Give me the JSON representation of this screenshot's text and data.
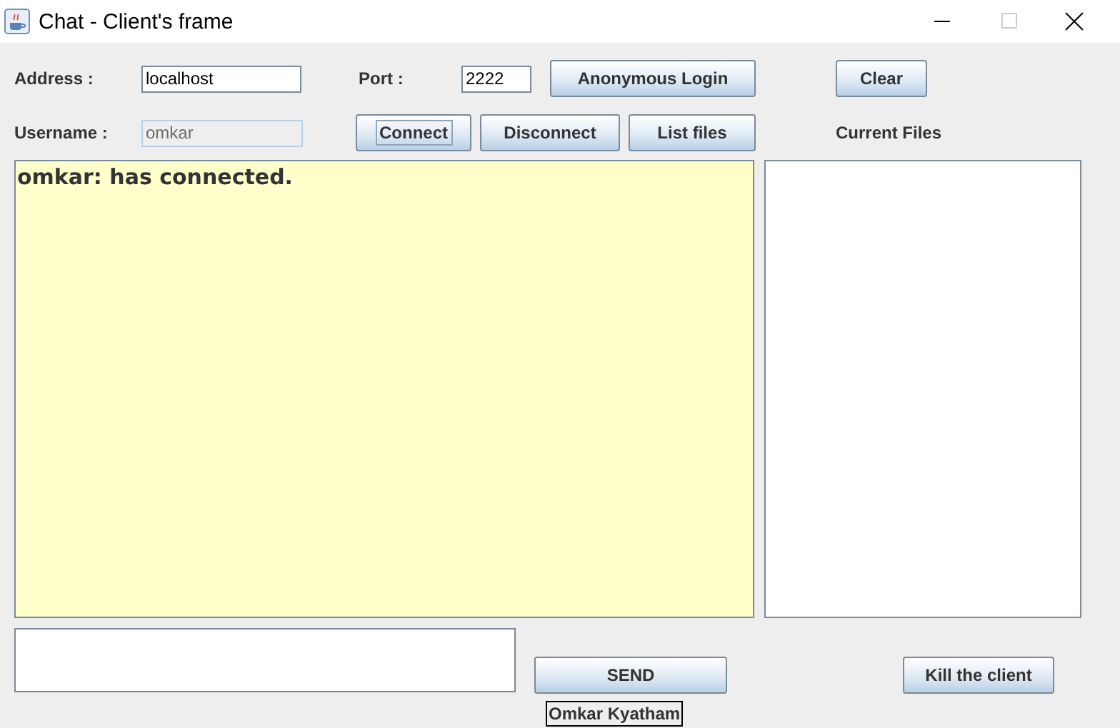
{
  "window": {
    "title": "Chat - Client's frame"
  },
  "address": {
    "label": "Address :",
    "value": "localhost"
  },
  "port": {
    "label": "Port :",
    "value": "2222"
  },
  "username": {
    "label": "Username :",
    "value": "omkar",
    "disabled": true
  },
  "buttons": [
    {
      "kind": "anonymous",
      "label": "Anonymous Login",
      "focused": false
    },
    {
      "kind": "clear",
      "label": "Clear",
      "focused": false
    },
    {
      "kind": "connect",
      "label": "Connect",
      "focused": true
    },
    {
      "kind": "disconnect",
      "label": "Disconnect",
      "focused": false
    },
    {
      "kind": "list",
      "label": "List files",
      "focused": false
    },
    {
      "kind": "send",
      "label": "SEND",
      "focused": false
    },
    {
      "kind": "kill",
      "label": "Kill the client",
      "focused": false
    }
  ],
  "files_label": "Current Files",
  "chat": {
    "messages": [
      "omkar: has connected."
    ]
  },
  "footer": "Omkar Kyatham"
}
